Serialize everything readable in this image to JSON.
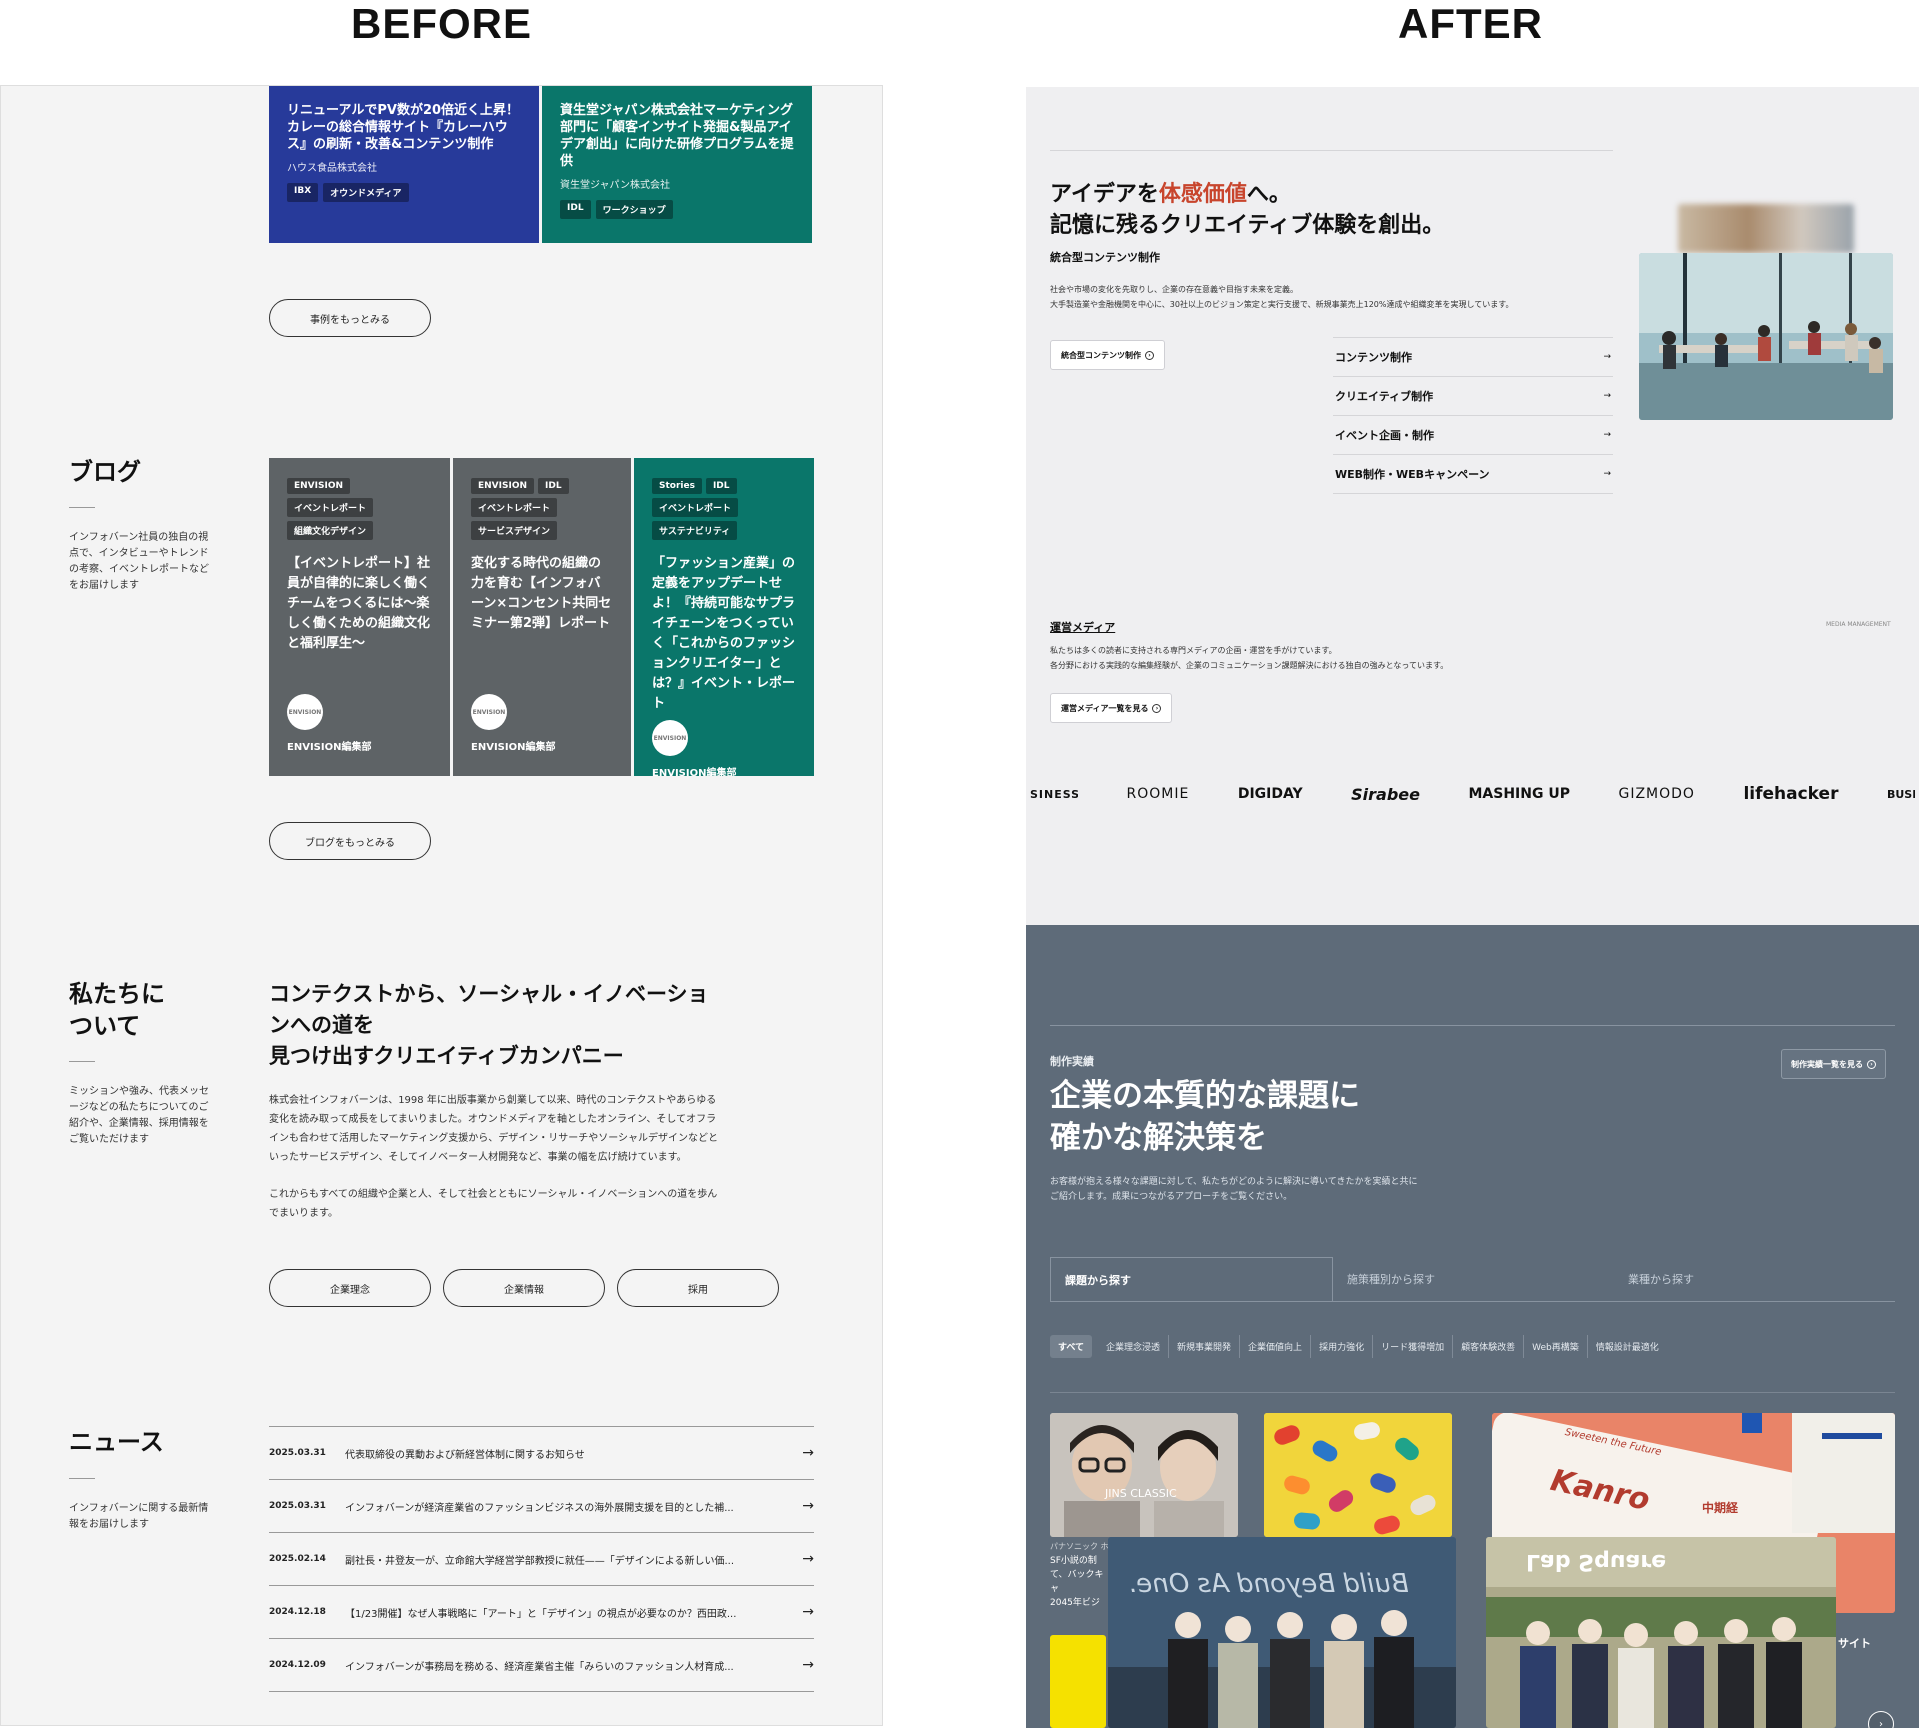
{
  "headings": {
    "before": "BEFORE",
    "after": "AFTER"
  },
  "before": {
    "top_cards": [
      {
        "title": "リニューアルでPV数が20倍近く上昇！カレーの総合情報サイト『カレーハウス』の刷新・改善&コンテンツ制作",
        "company": "ハウス食品株式会社",
        "tags": [
          "IBX",
          "オウンドメディア"
        ],
        "color": "#273a9a"
      },
      {
        "title": "資生堂ジャパン株式会社マーケティング部門に「顧客インサイト発掘&製品アイデア創出」に向けた研修プログラムを提供",
        "company": "資生堂ジャパン株式会社",
        "tags": [
          "IDL",
          "ワークショップ"
        ],
        "color": "#0a766a"
      }
    ],
    "more_cases_button": "事例をもっとみる",
    "blog": {
      "title": "ブログ",
      "desc": "インフォバーン社員の独自の視点で、インタビューやトレンドの考察、イベントレポートなどをお届けします",
      "cards": [
        {
          "tags": [
            [
              "ENVISION"
            ],
            [
              "イベントレポート"
            ],
            [
              "組織文化デザイン"
            ]
          ],
          "title": "【イベントレポート】社員が自律的に楽しく働くチームをつくるには〜楽しく働くための組織文化と福利厚生〜",
          "author": "ENVISION編集部",
          "avatar": "ENVISION",
          "color": "#5e6366"
        },
        {
          "tags": [
            [
              "ENVISION",
              "IDL"
            ],
            [
              "イベントレポート"
            ],
            [
              "サービスデザイン"
            ]
          ],
          "title": "変化する時代の組織の力を育む【インフォバーン×コンセント共同セミナー第2弾】レポート",
          "author": "ENVISION編集部",
          "avatar": "ENVISION",
          "color": "#5e6366"
        },
        {
          "tags": [
            [
              "Stories",
              "IDL"
            ],
            [
              "イベントレポート"
            ],
            [
              "サステナビリティ"
            ]
          ],
          "title": "「ファッション産業」の定義をアップデートせよ！『持続可能なサプライチェーンをつくっていく「これからのファッションクリエイター」とは？』イベント・レポート",
          "author": "ENVISION編集部",
          "avatar": "ENVISION",
          "color": "#0a766a"
        }
      ],
      "more_button": "ブログをもっとみる"
    },
    "about": {
      "title_lines": [
        "私たちに",
        "ついて"
      ],
      "desc": "ミッションや強み、代表メッセージなどの私たちについてのご紹介や、企業情報、採用情報をご覧いただけます",
      "heading_lines": [
        "コンテクストから、ソーシャル・イノベーショ",
        "ンへの道を",
        "見つけ出すクリエイティブカンパニー"
      ],
      "para1_lines": [
        "株式会社インフォバーンは、1998 年に出版事業から創業して以来、時代のコンテクストやあらゆる",
        "変化を読み取って成長をしてまいりました。オウンドメディアを軸としたオンライン、そしてオフラ",
        "インも合わせて活用したマーケティング支援から、デザイン・リサーチやソーシャルデザインなどと",
        "いったサービスデザイン、そしてイノベーター人材開発など、事業の幅を広げ続けています。"
      ],
      "para2_lines": [
        "これからもすべての組織や企業と人、そして社会とともにソーシャル・イノベーションへの道を歩ん",
        "でまいります。"
      ],
      "buttons": [
        "企業理念",
        "企業情報",
        "採用"
      ]
    },
    "news": {
      "title": "ニュース",
      "desc": "インフォバーンに関する最新情報をお届けします",
      "items": [
        {
          "date": "2025.03.31",
          "text": "代表取締役の異動および新経営体制に関するお知らせ"
        },
        {
          "date": "2025.03.31",
          "text": "インフォバーンが経済産業省のファッションビジネスの海外展開支援を目的とした補..."
        },
        {
          "date": "2025.02.14",
          "text": "副社長・井登友一が、立命館大学経営学部教授に就任——「デザインによる新しい価..."
        },
        {
          "date": "2024.12.18",
          "text": "【1/23開催】なぜ人事戦略に「アート」と「デザイン」の視点が必要なのか？西田政..."
        },
        {
          "date": "2024.12.09",
          "text": "インフォバーンが事務局を務める、経済産業省主催「みらいのファッション人材育成..."
        }
      ]
    }
  },
  "after": {
    "hero": {
      "line1_prefix": "アイデアを",
      "line1_accent": "体感価値",
      "line1_suffix": "へ。",
      "line2": "記憶に残るクリエイティブ体験を創出。",
      "sub": "統合型コンテンツ制作",
      "desc_lines": [
        "社会や市場の変化を先取りし、企業の存在意義や目指す未来を定義。",
        "大手製造業や金融機関を中心に、30社以上のビジョン策定と実行支援で、新規事業売上120%達成や組織変革を実現しています。"
      ],
      "button": "統合型コンテンツ制作",
      "services": [
        "コンテンツ制作",
        "クリエイティブ制作",
        "イベント企画・制作",
        "WEB制作・WEBキャンペーン"
      ]
    },
    "media": {
      "title": "運営メディア",
      "eyebrow": "MEDIA MANAGEMENT",
      "desc_lines": [
        "私たちは多くの読者に支持される専門メディアの企画・運営を手がけています。",
        "各分野における実践的な編集経験が、企業のコミュニケーション課題解決における独自の強みとなっています。"
      ],
      "button": "運営メディア一覧を見る",
      "logos": [
        "SINESS NSIDER",
        "ROOMIE",
        "DIGIDAY",
        "Sirabee",
        "MASHING UP",
        "GIZMODO",
        "lifehacker",
        "BUSI INSI"
      ]
    },
    "works": {
      "label": "制作実績",
      "heading_lines": [
        "企業の本質的な課題に",
        "確かな解決策を"
      ],
      "desc_lines": [
        "お客様が抱える様々な課題に対して、私たちがどのように解決に導いてきたかを実績と共に",
        "ご紹介します。成果につながるアプローチをご覧ください。"
      ],
      "list_button": "制作実績一覧を見る",
      "tabs": [
        "課題から探す",
        "施策種別から探す",
        "業種から探す"
      ],
      "chips": [
        "すべて",
        "企業理念浸透",
        "新規事業開発",
        "企業価値向上",
        "採用力強化",
        "リード獲得増加",
        "顧客体験改善",
        "Web再構築",
        "情報設計最適化"
      ],
      "card_caption_lines": [
        "パナソニック ホ",
        "SF小説の制",
        "て、バックキャ",
        "2045年ビジ"
      ],
      "photo_texts": {
        "glasses": "JINS CLASSIC",
        "kanro": "Kanro",
        "kanro_tagline": "Sweeten the Future",
        "kanro_side": "中期経",
        "team1_sign": "Build Beyond As One.",
        "team2_sign": "Lab Square"
      },
      "side_caption": "サイト"
    }
  }
}
